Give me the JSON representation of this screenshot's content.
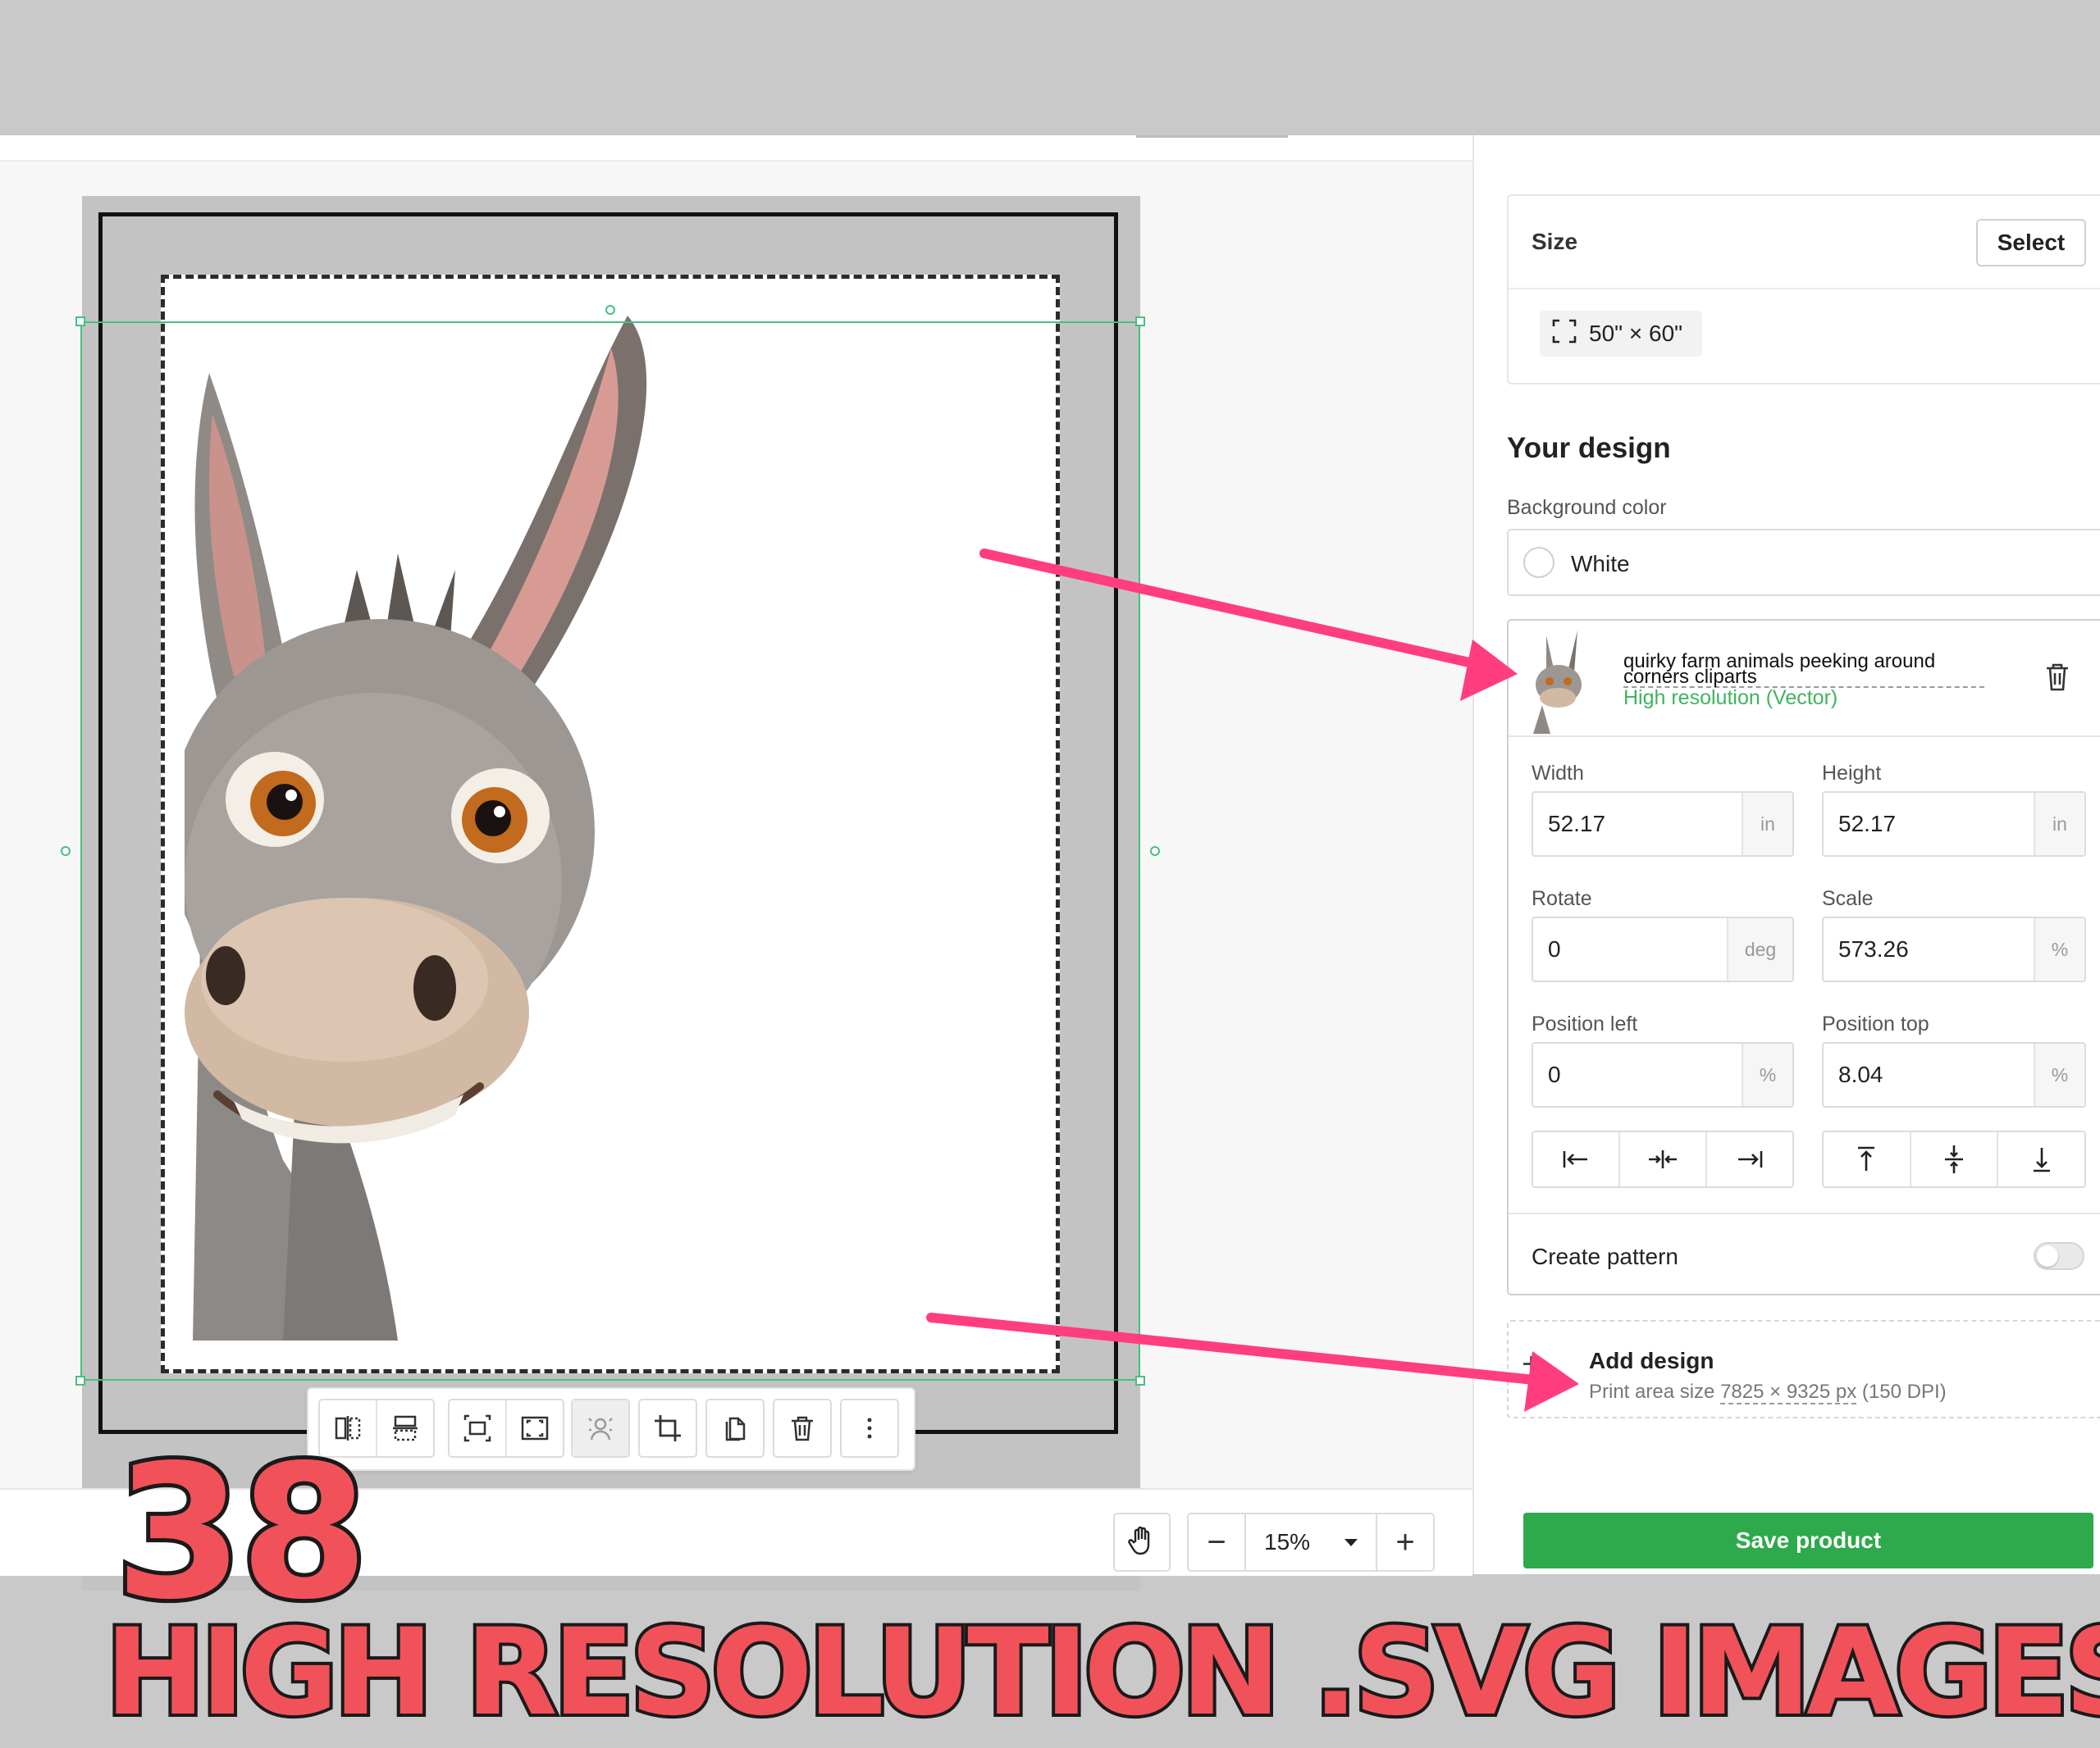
{
  "size_card": {
    "label": "Size",
    "select_label": "Select",
    "dimensions": "50\" × 60\""
  },
  "design": {
    "heading": "Your design",
    "bg_label": "Background color",
    "bg_value": "White",
    "layer": {
      "name": "quirky farm animals peeking around corners cliparts",
      "resolution": "High resolution (Vector)"
    },
    "fields": {
      "width": {
        "label": "Width",
        "value": "52.17",
        "unit": "in"
      },
      "height": {
        "label": "Height",
        "value": "52.17",
        "unit": "in"
      },
      "rotate": {
        "label": "Rotate",
        "value": "0",
        "unit": "deg"
      },
      "scale": {
        "label": "Scale",
        "value": "573.26",
        "unit": "%"
      },
      "pos_left": {
        "label": "Position left",
        "value": "0",
        "unit": "%"
      },
      "pos_top": {
        "label": "Position top",
        "value": "8.04",
        "unit": "%"
      }
    },
    "create_pattern": "Create pattern",
    "create_pattern_on": false
  },
  "add_design": {
    "plus": "+",
    "title": "Add design",
    "sub_prefix": "Print area size ",
    "sub_px": "7825 × 9325 px",
    "sub_suffix": " (150 DPI)"
  },
  "save_label": "Save product",
  "zoom": {
    "minus": "−",
    "value": "15%",
    "plus": "+"
  },
  "icons": {
    "toolbar": [
      "flip-horizontal-icon",
      "flip-vertical-icon",
      "fit-to-print-area-icon",
      "fill-print-area-icon",
      "remove-background-icon",
      "crop-icon",
      "duplicate-icon",
      "delete-icon",
      "more-icon"
    ],
    "align": [
      "align-left-icon",
      "align-center-horizontal-icon",
      "align-right-icon",
      "align-top-icon",
      "align-center-vertical-icon",
      "align-bottom-icon"
    ]
  },
  "colors": {
    "accent_green": "#2ea94b",
    "selection_green": "#45c17e",
    "promo_red": "#f1525a",
    "arrow_pink": "#ff3d7f"
  },
  "promo": {
    "count": "38",
    "title": "High resolution .SVG images"
  }
}
